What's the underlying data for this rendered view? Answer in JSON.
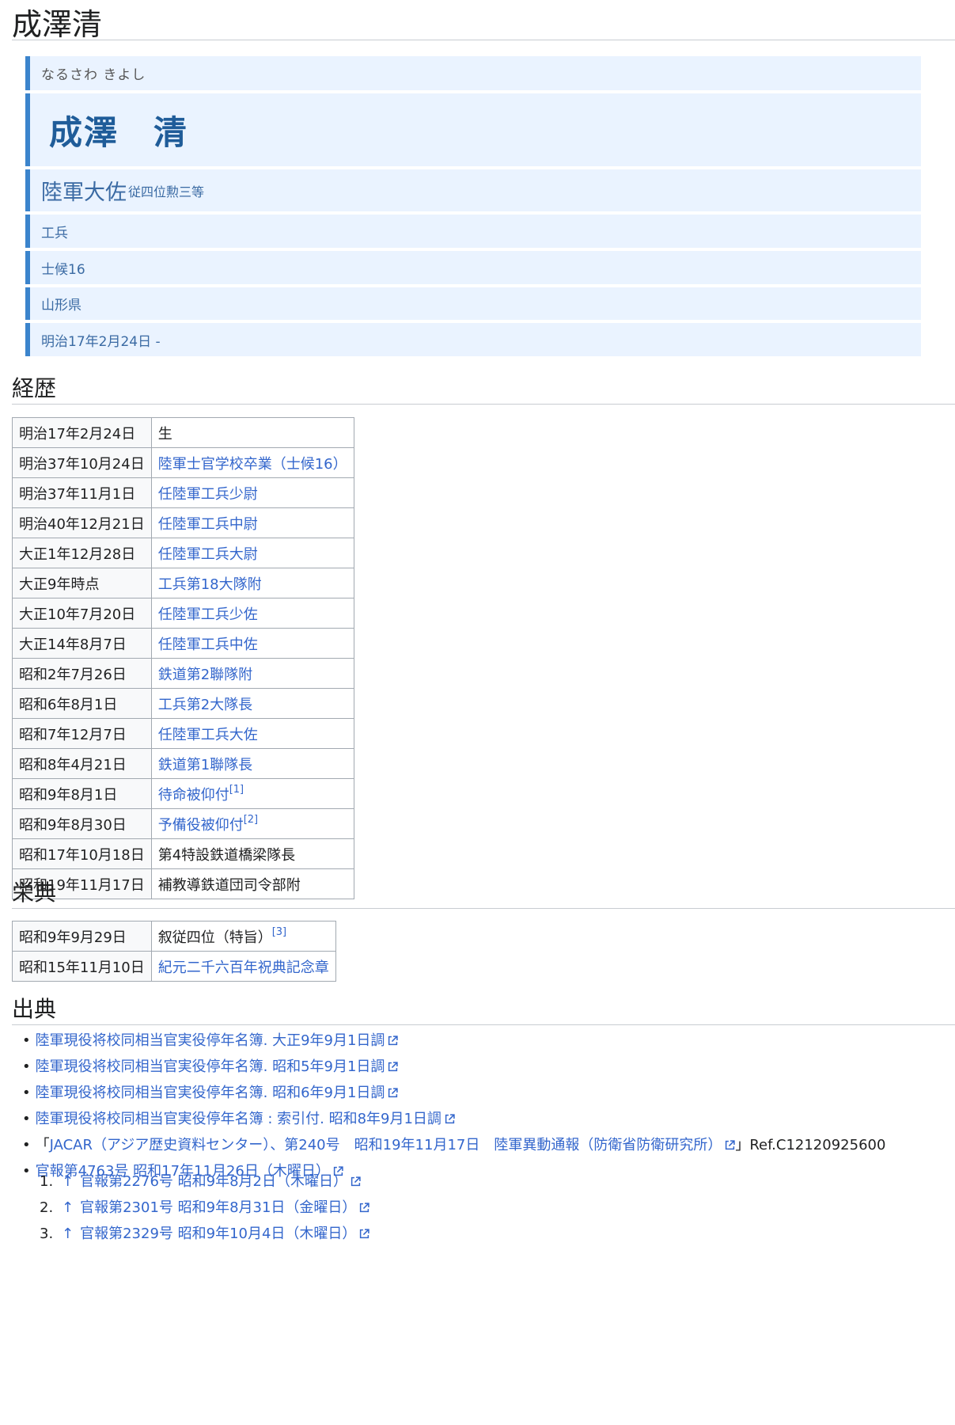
{
  "page_title": "成澤清",
  "infobox": {
    "reading": "なるさわ きよし",
    "name": "成澤　清",
    "rank": "陸軍大佐",
    "rank_sub": "従四位勲三等",
    "branch": "工兵",
    "class": "士候16",
    "birthplace": "山形県",
    "dates": "明治17年2月24日 -"
  },
  "career": {
    "heading": "経歴",
    "rows": [
      {
        "date": "明治17年2月24日",
        "event": "生",
        "linked": false
      },
      {
        "date": "明治37年10月24日",
        "event": "陸軍士官学校卒業（士候16）",
        "linked": true
      },
      {
        "date": "明治37年11月1日",
        "event": "任陸軍工兵少尉",
        "linked": true
      },
      {
        "date": "明治40年12月21日",
        "event": "任陸軍工兵中尉",
        "linked": true
      },
      {
        "date": "大正1年12月28日",
        "event": "任陸軍工兵大尉",
        "linked": true
      },
      {
        "date": "大正9年時点",
        "event": "工兵第18大隊附",
        "linked": true
      },
      {
        "date": "大正10年7月20日",
        "event": "任陸軍工兵少佐",
        "linked": true
      },
      {
        "date": "大正14年8月7日",
        "event": "任陸軍工兵中佐",
        "linked": true
      },
      {
        "date": "昭和2年7月26日",
        "event": "鉄道第2聯隊附",
        "linked": true
      },
      {
        "date": "昭和6年8月1日",
        "event": "工兵第2大隊長",
        "linked": true
      },
      {
        "date": "昭和7年12月7日",
        "event": "任陸軍工兵大佐",
        "linked": true
      },
      {
        "date": "昭和8年4月21日",
        "event": "鉄道第1聯隊長",
        "linked": true
      },
      {
        "date": "昭和9年8月1日",
        "event": "待命被仰付",
        "linked": true,
        "ref": "[1]"
      },
      {
        "date": "昭和9年8月30日",
        "event": "予備役被仰付",
        "linked": true,
        "ref": "[2]"
      },
      {
        "date": "昭和17年10月18日",
        "event": "第4特設鉄道橋梁隊長",
        "linked": false
      },
      {
        "date": "昭和19年11月17日",
        "event": "補教導鉄道団司令部附",
        "linked": false
      }
    ]
  },
  "honors": {
    "heading": "栄典",
    "rows": [
      {
        "date": "昭和9年9月29日",
        "event": "叙従四位（特旨）",
        "linked": false,
        "ref": "[3]"
      },
      {
        "date": "昭和15年11月10日",
        "event": "紀元二千六百年祝典記念章",
        "linked": true
      }
    ]
  },
  "sources": {
    "heading": "出典",
    "items": [
      {
        "text": "陸軍現役将校同相当官実役停年名簿. 大正9年9月1日調",
        "suffix": ""
      },
      {
        "text": "陸軍現役将校同相当官実役停年名簿. 昭和5年9月1日調",
        "suffix": ""
      },
      {
        "text": "陸軍現役将校同相当官実役停年名簿. 昭和6年9月1日調",
        "suffix": ""
      },
      {
        "text": "陸軍現役将校同相当官実役停年名簿 : 索引付. 昭和8年9月1日調",
        "suffix": ""
      },
      {
        "prefix": "「",
        "text": "JACAR（アジア歴史資料センター）、第240号　昭和19年11月17日　陸軍異動通報（防衛省防衛研究所）",
        "suffix": "」Ref.C12120925600"
      },
      {
        "text": "官報第4763号 昭和17年11月26日（木曜日）",
        "suffix": ""
      }
    ]
  },
  "notes": [
    {
      "num": "1.",
      "arrow": "↑",
      "text": "官報第2276号 昭和9年8月2日（木曜日）"
    },
    {
      "num": "2.",
      "arrow": "↑",
      "text": "官報第2301号 昭和9年8月31日（金曜日）"
    },
    {
      "num": "3.",
      "arrow": "↑",
      "text": "官報第2329号 昭和9年10月4日（木曜日）"
    }
  ]
}
